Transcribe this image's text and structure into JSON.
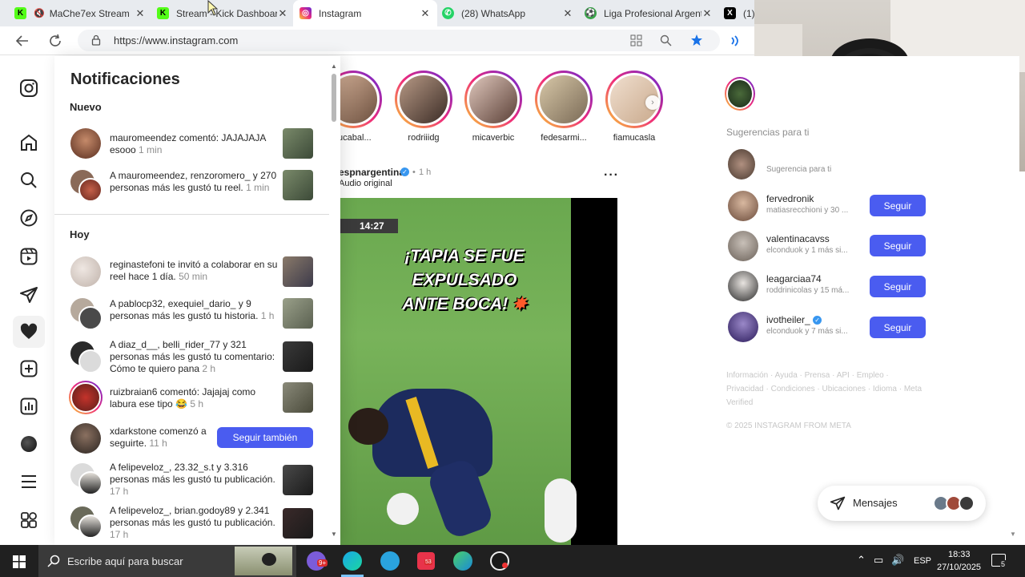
{
  "browser": {
    "tabs": [
      {
        "title": "MaChe7ex Stream",
        "favicon": "kick-icon",
        "color": "#53fc18"
      },
      {
        "title": "Stream - Kick Dashboard",
        "favicon": "kick-icon",
        "color": "#53fc18"
      },
      {
        "title": "Instagram",
        "favicon": "instagram-icon",
        "color": "#e1306c",
        "active": true
      },
      {
        "title": "(28) WhatsApp",
        "favicon": "whatsapp-icon",
        "color": "#25d366"
      },
      {
        "title": "Liga Profesional Argentina",
        "favicon": "soccer-ball-icon",
        "color": "#3aa34a"
      },
      {
        "title": "(1)",
        "favicon": "x-icon",
        "color": "#000000"
      }
    ],
    "url": "https://www.instagram.com"
  },
  "notifications": {
    "title": "Notificaciones",
    "section_new": "Nuevo",
    "section_today": "Hoy",
    "new_items": [
      {
        "text": "mauromeendez comentó: JAJAJAJA esooo",
        "time": "1 min"
      },
      {
        "text": "A mauromeendez, renzoromero_ y 270 personas más les gustó tu reel.",
        "time": "1 min"
      }
    ],
    "today_items": [
      {
        "text": "reginastefoni te invitó a colaborar en su reel hace 1 día.",
        "time": "50 min"
      },
      {
        "text": "A pablocp32, exequiel_dario_ y 9 personas más les gustó tu historia.",
        "time": "1 h"
      },
      {
        "text": "A diaz_d__, belli_rider_77 y 321 personas más les gustó tu comentario: Cómo te quiero pana",
        "time": "2 h"
      },
      {
        "text": "ruizbraian6 comentó: Jajajaj como labura ese tipo 😂",
        "time": "5 h"
      },
      {
        "text": "xdarkstone comenzó a seguirte.",
        "time": "11 h",
        "button": "Seguir también"
      },
      {
        "text": "A felipeveloz_, 23.32_s.t y 3.316 personas más les gustó tu publicación.",
        "time": "17 h"
      },
      {
        "text": "A felipeveloz_, brian.godoy89 y 2.341 personas más les gustó tu publicación.",
        "time": "17 h"
      }
    ]
  },
  "feed": {
    "stories": [
      "rucabal...",
      "rodriiidg",
      "micaverbic",
      "fedesarmi...",
      "fiamucasla"
    ],
    "post": {
      "author": "espnargentina",
      "time": "1 h",
      "audio": "Audio original",
      "clock": "14:27",
      "caption_line1": "¡TAPIA SE FUE EXPULSADO",
      "caption_line2": "ANTE BOCA!"
    }
  },
  "suggestions": {
    "header": "Sugerencias para ti",
    "partial_sub": "Sugerencia para ti",
    "items": [
      {
        "username": "fervedronik",
        "sub": "matiasrecchioni y 30 ...",
        "button": "Seguir"
      },
      {
        "username": "valentinacavss",
        "sub": "elconduok y 1 más si...",
        "button": "Seguir"
      },
      {
        "username": "leagarciaa74",
        "sub": "roddrinicolas y 15 má...",
        "button": "Seguir"
      },
      {
        "username": "ivotheiler_",
        "sub": "elconduok y 7 más si...",
        "button": "Seguir",
        "verified": true
      }
    ],
    "footer_links": [
      "Información",
      "Ayuda",
      "Prensa",
      "API",
      "Empleo",
      "Privacidad",
      "Condiciones",
      "Ubicaciones",
      "Idioma",
      "Meta Verified"
    ],
    "copyright": "© 2025 INSTAGRAM FROM META"
  },
  "messages": {
    "label": "Mensajes"
  },
  "taskbar": {
    "search_placeholder": "Escribe aquí para buscar",
    "language": "ESP",
    "time": "18:33",
    "date": "27/10/2025",
    "notification_count": "5",
    "badge_count": "53"
  }
}
